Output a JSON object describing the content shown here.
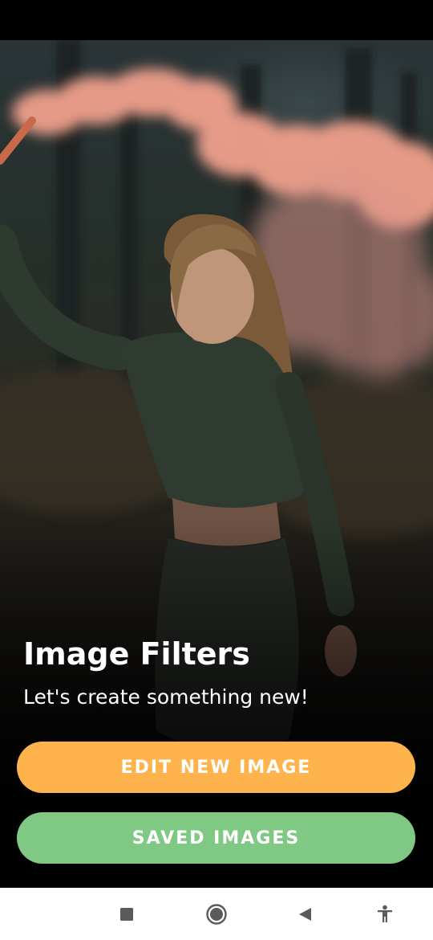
{
  "screen": {
    "title": "Image Filters",
    "subtitle": "Let's create something new!"
  },
  "actions": {
    "edit_label": "EDIT NEW IMAGE",
    "saved_label": "SAVED IMAGES"
  },
  "colors": {
    "edit_button": "#ffb34d",
    "saved_button": "#80c985",
    "smoke": "#f0a08c"
  },
  "system_nav": {
    "icons": [
      "recents-icon",
      "home-icon",
      "back-icon",
      "accessibility-icon"
    ]
  }
}
